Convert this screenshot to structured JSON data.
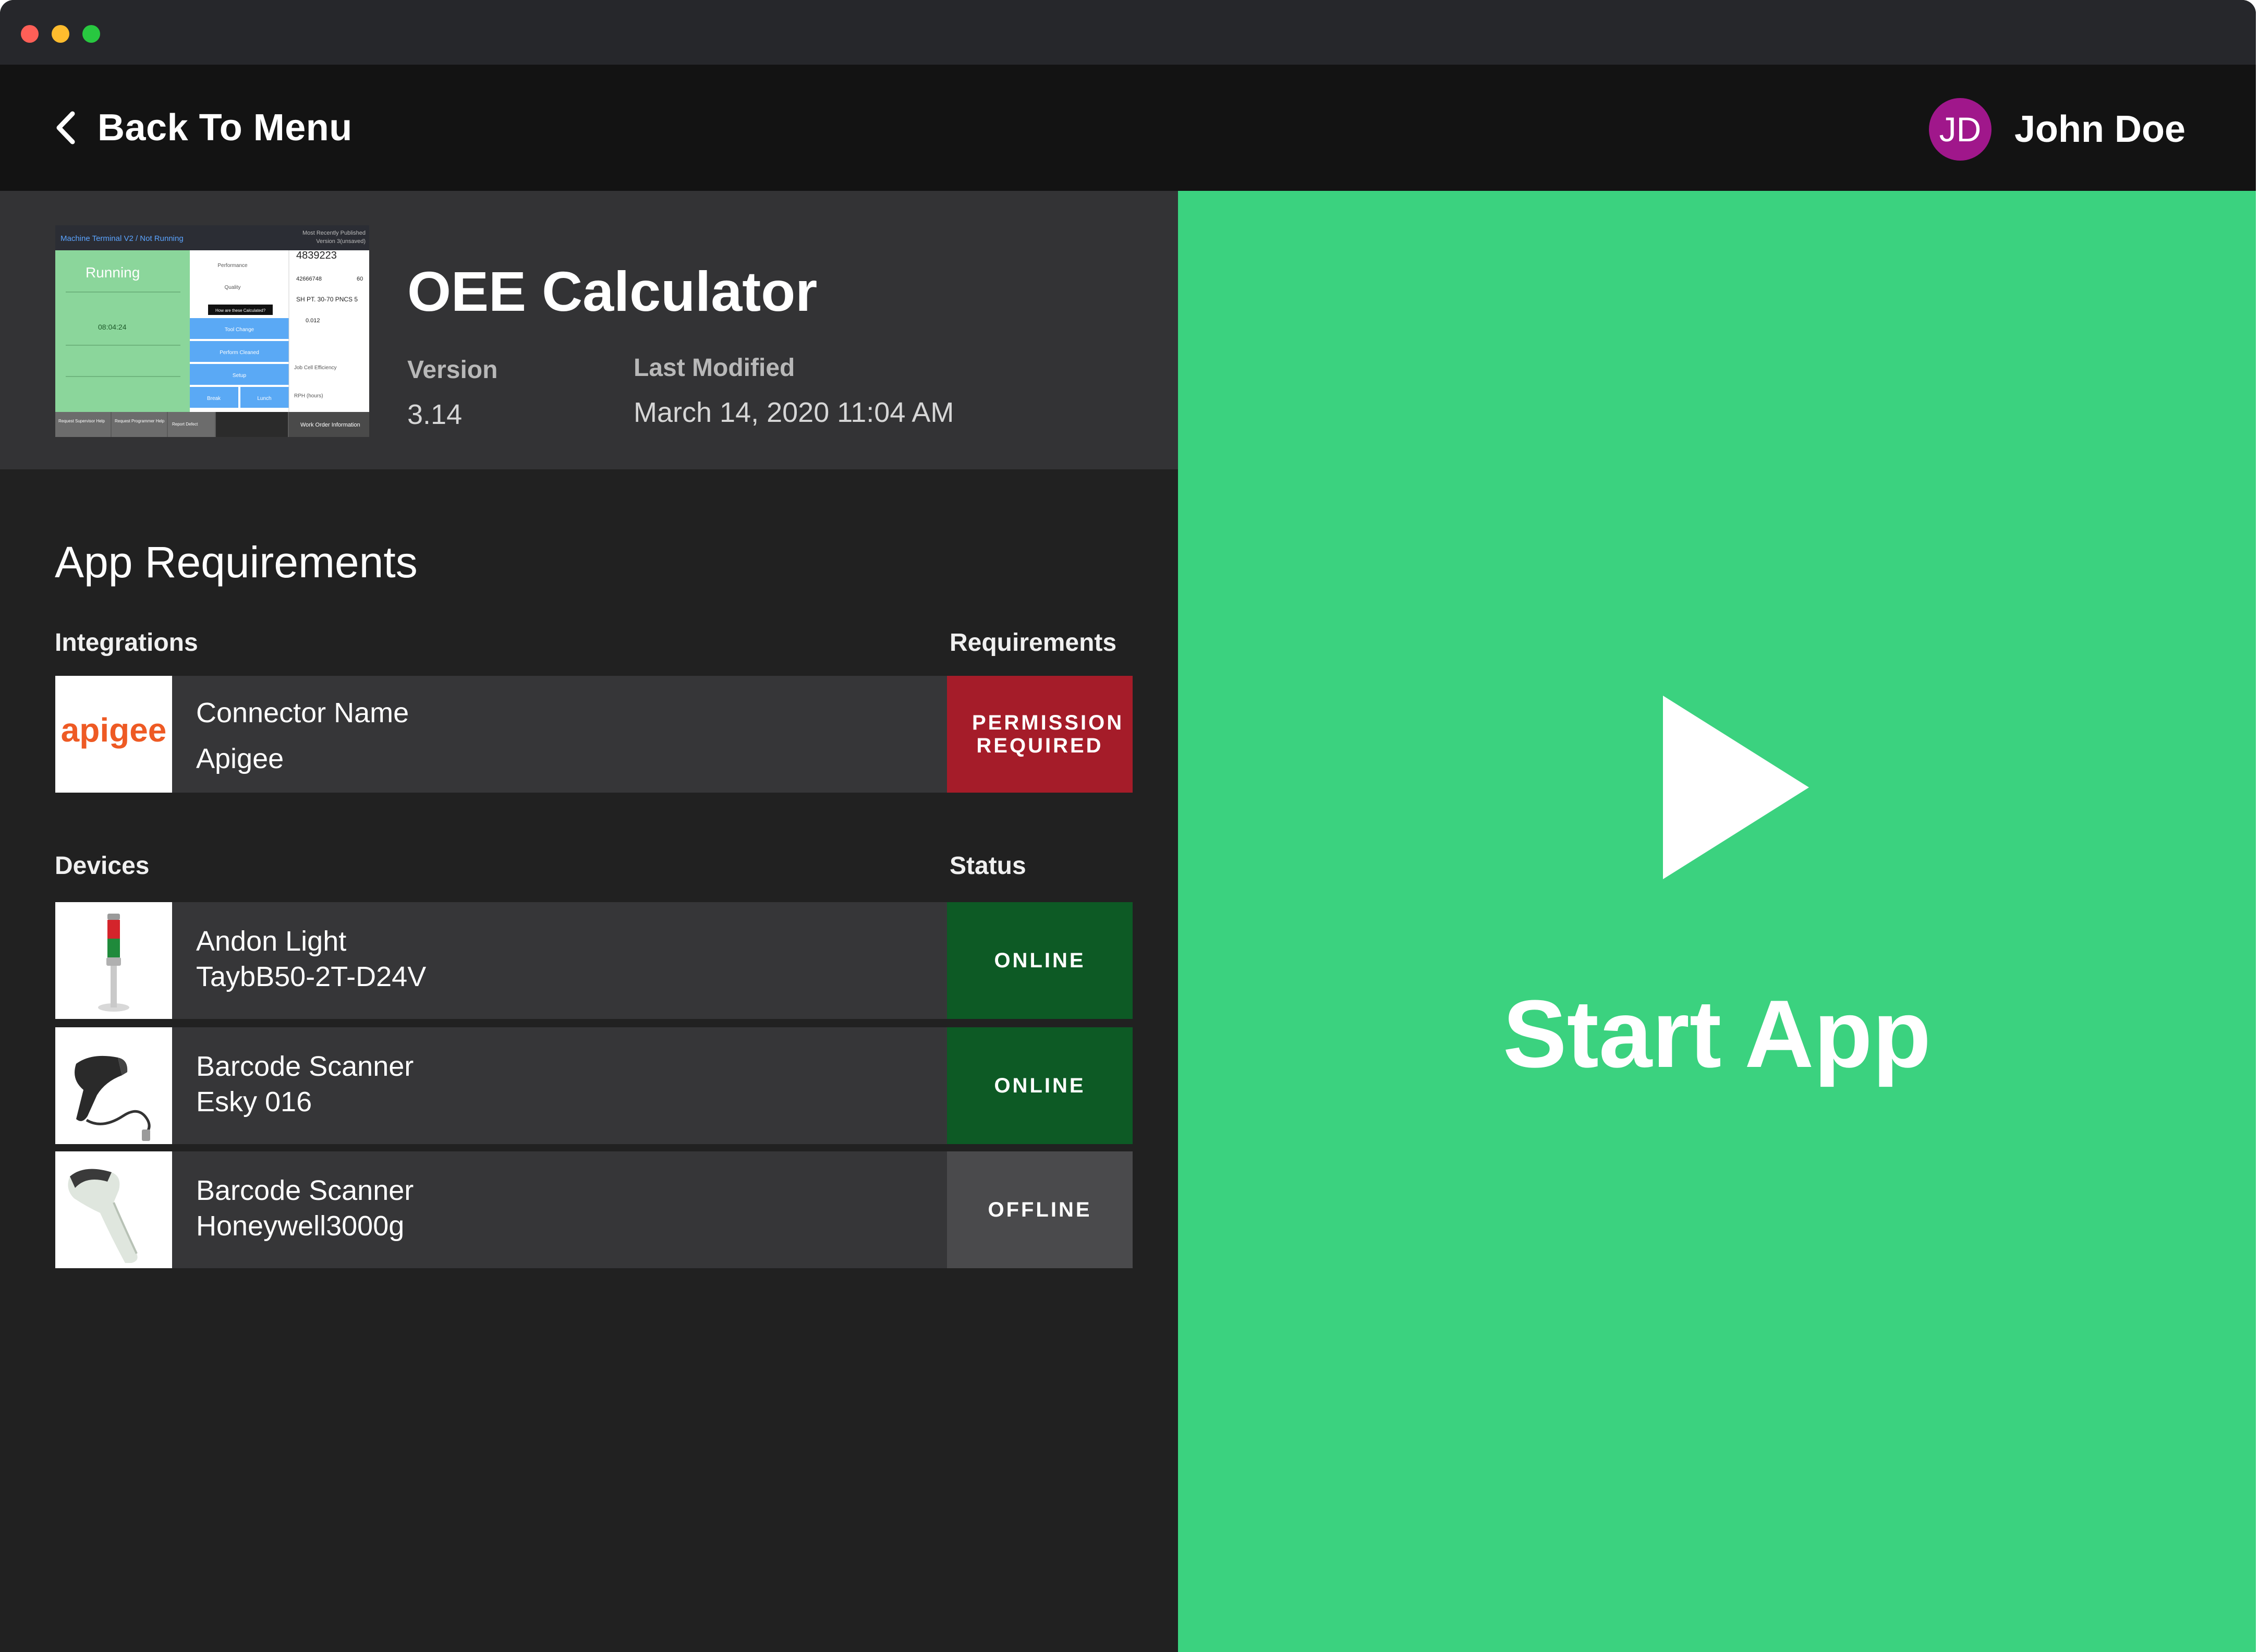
{
  "header": {
    "back_label": "Back To Menu",
    "user_initials": "JD",
    "user_name": "John Doe",
    "avatar_color": "#a0178b"
  },
  "app": {
    "title": "OEE Calculator",
    "version_label": "Version",
    "version": "3.14",
    "last_modified_label": "Last Modified",
    "last_modified": "March 14, 2020 11:04 AM",
    "thumbnail": {
      "breadcrumb": "Machine Terminal V2 / Not Running",
      "corner_text_1": "Most Recently Published",
      "corner_text_2": "Version 3(unsaved)",
      "status": "Running",
      "timer": "08:04:24",
      "metric_1": "Performance",
      "metric_2": "Quality",
      "highlight_button": "How are these Calculated?",
      "blue_button_1": "Tool Change",
      "blue_button_2": "Perform Cleaned",
      "blue_button_3": "Setup",
      "blue_button_4": "Break",
      "blue_button_5": "Lunch",
      "job_number": "4839223",
      "part_number": "42666748",
      "quantity": "60",
      "part_description": "SH PT. 30-70 PNCS 5",
      "cycle_time": "0.012",
      "efficiency_label": "Job Cell Efficiency",
      "rate_label": "RPH (hours)",
      "footer_1": "Request Supervisor Help",
      "footer_2": "Request Programmer Help",
      "footer_3": "Report Defect",
      "footer_4": "Work Order Information"
    }
  },
  "requirements": {
    "title": "App Requirements",
    "integrations_header": "Integrations",
    "requirements_header": "Requirements",
    "integrations": [
      {
        "logo_text": "apigee",
        "line1": "Connector Name",
        "line2": "Apigee",
        "badge": "PERMISSION REQUIRED"
      }
    ],
    "devices_header": "Devices",
    "status_header": "Status",
    "devices": [
      {
        "line1": "Andon Light",
        "line2": "TaybB50-2T-D24V",
        "status": "ONLINE"
      },
      {
        "line1": "Barcode Scanner",
        "line2": "Esky 016",
        "status": "ONLINE"
      },
      {
        "line1": "Barcode Scanner",
        "line2": "Honeywell3000g",
        "status": "OFFLINE"
      }
    ]
  },
  "start": {
    "label": "Start App",
    "color": "#3bd27f"
  },
  "colors": {
    "permission_red": "#a51c29",
    "online_green": "#0d5a25",
    "offline_gray": "#4a4a4c"
  }
}
